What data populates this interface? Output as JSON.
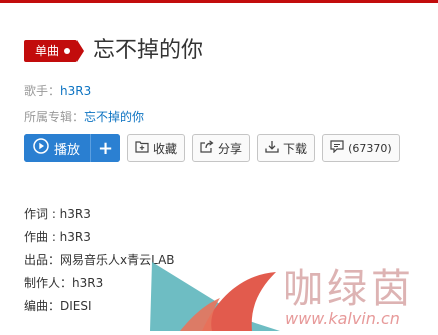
{
  "song": {
    "badge": "单曲",
    "title": "忘不掉的你",
    "artist_label": "歌手：",
    "artist": "h3R3",
    "album_label": "所属专辑：",
    "album": "忘不掉的你"
  },
  "actions": {
    "play": "播放",
    "add": "+",
    "collect": "收藏",
    "share": "分享",
    "download": "下载",
    "comments": "(67370)"
  },
  "credits": [
    "作词 : h3R3",
    "作曲 : h3R3",
    "出品：网易音乐人x青云LAB",
    "制作人：h3R3",
    "编曲：DIESI"
  ],
  "watermark": {
    "logo_text": "咖绿茵",
    "url": "www.kalvin.cn"
  },
  "colors": {
    "brand_red": "#c20c0c",
    "play_blue": "#2a7fd1",
    "link_blue": "#0c73c2"
  }
}
